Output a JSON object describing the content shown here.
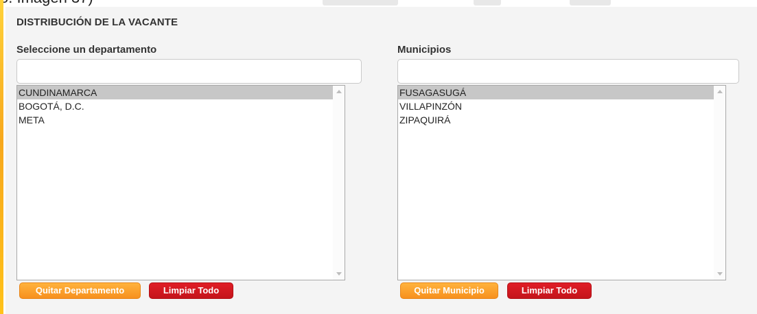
{
  "header": {
    "cut_caption": "o. Imagen 37)"
  },
  "section": {
    "title": "DISTRIBUCIÓN DE LA VACANTE"
  },
  "departamentos": {
    "label": "Seleccione un departamento",
    "filter_value": "",
    "items": [
      "CUNDINAMARCA",
      "BOGOTÁ, D.C.",
      "META"
    ],
    "selected_index": 0,
    "remove_button": "Quitar Departamento",
    "clear_button": "Limpiar Todo"
  },
  "municipios": {
    "label": "Municipios",
    "filter_value": "",
    "items": [
      "FUSAGASUGÁ",
      "VILLAPINZÓN",
      "ZIPAQUIRÁ"
    ],
    "selected_index": 0,
    "remove_button": "Quitar Municipio",
    "clear_button": "Limpiar Todo"
  },
  "colors": {
    "panel_bg": "#f4f4f4",
    "accent_orange": "#f7901e",
    "accent_red": "#c4141b",
    "selected_row": "#c7c7c7"
  },
  "icons": {
    "scroll_up": "scroll-up-arrow-icon",
    "scroll_down": "scroll-down-arrow-icon"
  }
}
